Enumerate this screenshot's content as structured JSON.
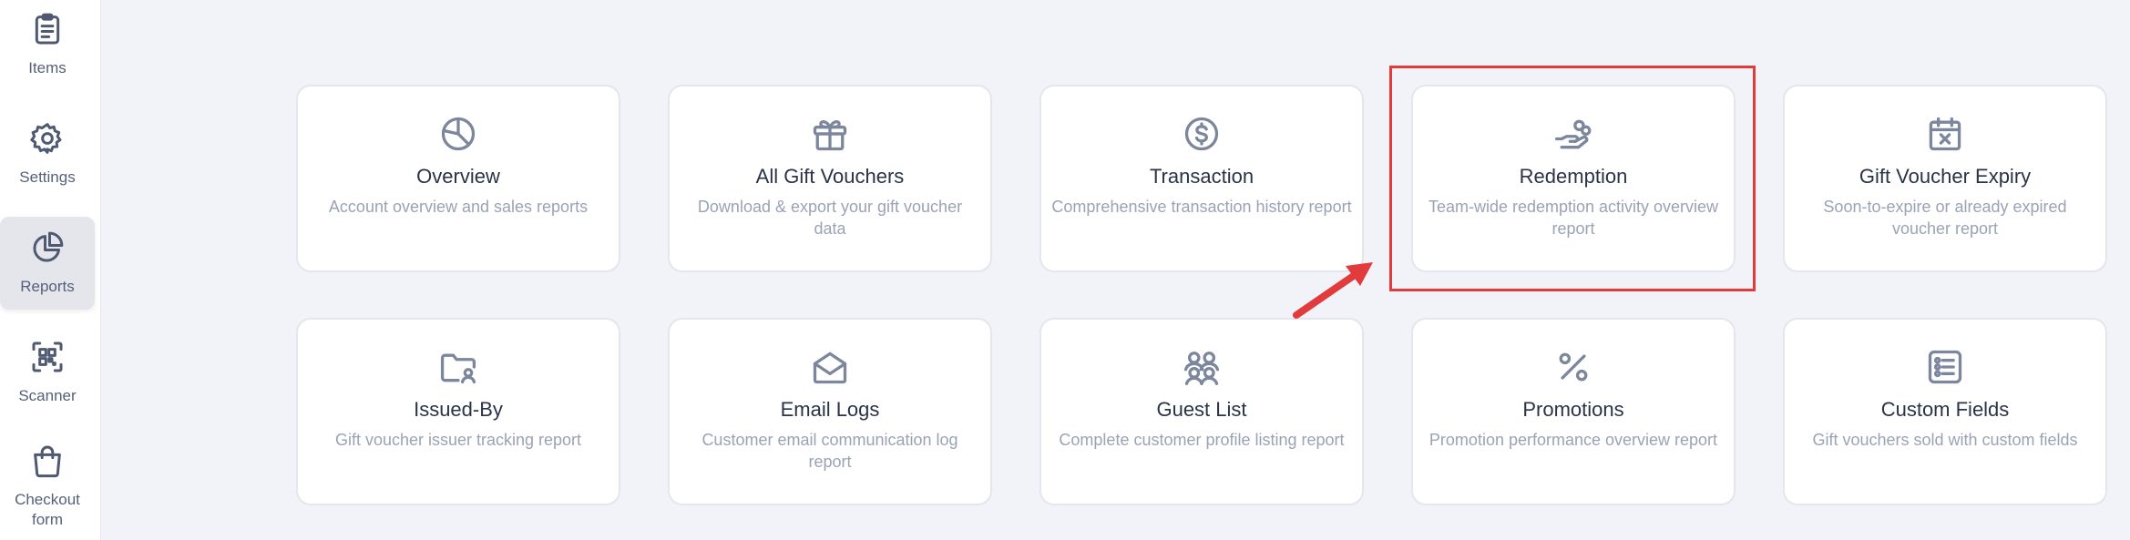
{
  "sidebar": {
    "items": [
      {
        "label": "Items",
        "icon": "clipboard-icon"
      },
      {
        "label": "Settings",
        "icon": "gear-icon"
      },
      {
        "label": "Reports",
        "icon": "pie-chart-icon",
        "active": true
      },
      {
        "label": "Scanner",
        "icon": "qr-scan-icon"
      },
      {
        "label": "Checkout form",
        "icon": "shopping-bag-icon"
      }
    ]
  },
  "reports": [
    {
      "title": "Overview",
      "desc": "Account overview and sales reports",
      "icon": "pie-chart-icon"
    },
    {
      "title": "All Gift Vouchers",
      "desc": "Download & export your gift voucher data",
      "icon": "gift-icon"
    },
    {
      "title": "Transaction",
      "desc": "Comprehensive transaction history report",
      "icon": "dollar-circle-icon"
    },
    {
      "title": "Redemption",
      "desc": "Team-wide redemption activity overview report",
      "icon": "hand-coins-icon",
      "highlighted": true
    },
    {
      "title": "Gift Voucher Expiry",
      "desc": "Soon-to-expire or already expired voucher report",
      "icon": "calendar-x-icon"
    },
    {
      "title": "Issued-By",
      "desc": "Gift voucher issuer tracking report",
      "icon": "folder-user-icon"
    },
    {
      "title": "Email Logs",
      "desc": "Customer email communication log report",
      "icon": "envelope-open-icon"
    },
    {
      "title": "Guest List",
      "desc": "Complete customer profile listing report",
      "icon": "users-group-icon"
    },
    {
      "title": "Promotions",
      "desc": "Promotion performance overview report",
      "icon": "percent-icon"
    },
    {
      "title": "Custom Fields",
      "desc": "Gift vouchers sold with custom fields",
      "icon": "list-checks-icon"
    }
  ],
  "colors": {
    "accent_highlight": "#e23b3b",
    "background": "#f1f3f8",
    "card_border": "#e3e6ec",
    "title_text": "#2a3347",
    "desc_text": "#9aa3b5"
  }
}
